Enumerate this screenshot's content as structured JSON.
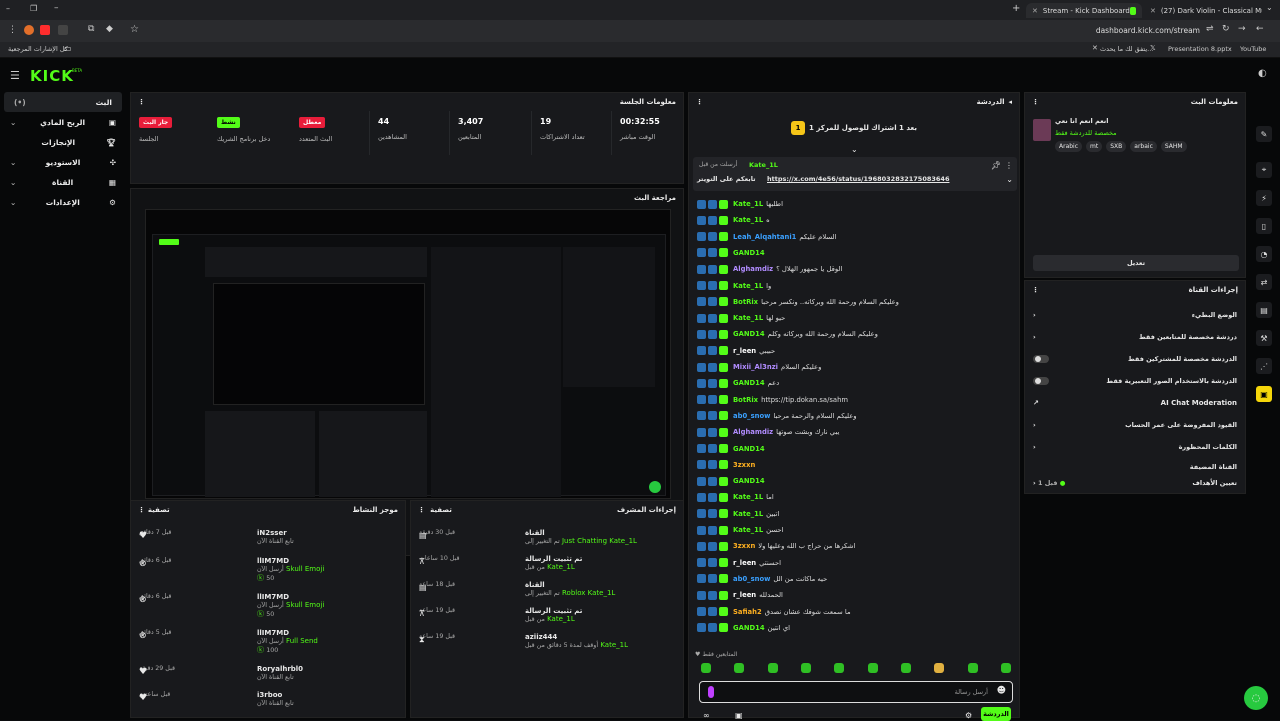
{
  "browser": {
    "tabs": [
      {
        "title": "Stream - Kick Dashboard"
      },
      {
        "title": "(27) Dark Violin - Classical Mu..."
      }
    ],
    "url": "dashboard.kick.com/stream",
    "bookmarks": {
      "all": "كل الإشارات المرجعية",
      "b1": "يتفق لك ما يحدث...",
      "b2": "Presentation 8.pptx",
      "b3": "YouTube"
    }
  },
  "nav": {
    "logo": "KICK",
    "items": [
      {
        "label": "البث"
      },
      {
        "label": "الربح المادي"
      },
      {
        "label": "الإنجازات"
      },
      {
        "label": "الاستوديو"
      },
      {
        "label": "القناة"
      },
      {
        "label": "الإعدادات"
      }
    ]
  },
  "session": {
    "title": "معلومات الجلسة",
    "stats": [
      {
        "value": "جار البث",
        "label": "الجلسة"
      },
      {
        "value": "نشط",
        "label": "دخل برنامج الشريك"
      },
      {
        "value": "معطل",
        "label": "البث المتعدد"
      },
      {
        "value": "44",
        "label": "المشاهدين"
      },
      {
        "value": "3,407",
        "label": "المتابعين"
      },
      {
        "value": "19",
        "label": "تعداد الاشتراكات"
      },
      {
        "value": "00:32:55",
        "label": "الوقت مباشر"
      }
    ]
  },
  "preview": {
    "title": "مراجعة البث"
  },
  "activity": {
    "title": "موجز النشاط",
    "filter": "تصفية",
    "items": [
      {
        "user": "iN2sser",
        "desc": "تابع القناة الآن",
        "time": "قبل 7 دقائق",
        "extra": ""
      },
      {
        "user": "llIM7MD",
        "desc": "أرسل الآن",
        "gift": "Skull Emoji",
        "amount": "50",
        "time": "قبل 6 دقائق"
      },
      {
        "user": "llIM7MD",
        "desc": "أرسل الآن",
        "gift": "Skull Emoji",
        "amount": "50",
        "time": "قبل 6 دقائق"
      },
      {
        "user": "llIM7MD",
        "desc": "أرسل الآن",
        "gift": "Full Send",
        "amount": "100",
        "time": "قبل 5 دقائق"
      },
      {
        "user": "Roryalhrbl0",
        "desc": "تابع القناة الآن",
        "time": "قبل 29 دقيقة",
        "extra": ""
      },
      {
        "user": "i3rboo",
        "desc": "تابع القناة الآن",
        "time": "قبل ساعتين",
        "extra": ""
      }
    ]
  },
  "modactions": {
    "title": "إجراءات المشرف",
    "filter": "تصفية",
    "items": [
      {
        "action": "القناة",
        "detail": "تم التغيير إلى",
        "target": "Just Chatting",
        "by": "Kate_1L",
        "time": "قبل 30 دقيقة"
      },
      {
        "action": "تم تثبيت الرسالة",
        "detail": "من قبل",
        "target": "",
        "by": "Kate_1L",
        "time": "قبل 10 ساعات"
      },
      {
        "action": "القناة",
        "detail": "تم التغيير إلى",
        "target": "Roblox",
        "by": "Kate_1L",
        "time": "قبل 18 ساعة"
      },
      {
        "action": "تم تثبيت الرسالة",
        "detail": "من قبل",
        "target": "",
        "by": "Kate_1L",
        "time": "قبل 19 ساعة"
      },
      {
        "action": "aziiz444",
        "detail": "أوقف لمدة 5 دقائق من قبل",
        "target": "",
        "by": "Kate_1L",
        "time": "قبل 19 ساعة"
      }
    ]
  },
  "chat": {
    "title": "الدردشة",
    "goal": "بعد 1 اشتراك للوصول للمركز 1",
    "goal_num": "1",
    "pinned_user": "Kate_1L",
    "pinned_time": "أرسلت من قبل",
    "pinned_text": "تابعكم على التويتر",
    "pinned_link": "https://x.com/4e56/status/1968032832175083646",
    "lines": [
      {
        "user": "Kate_1L",
        "text": "اطلبها",
        "color": "#53fc18"
      },
      {
        "user": "Kate_1L",
        "text": "ه",
        "color": "#53fc18"
      },
      {
        "user": "Leah_Alqahtani1",
        "text": "السلام عليكم",
        "color": "#3aa0ff"
      },
      {
        "user": "GAND14",
        "text": "",
        "color": "#53fc18"
      },
      {
        "user": "Alghamdiz",
        "text": "الوقل يا جمهور الهلال ؟",
        "color": "#b18cff"
      },
      {
        "user": "Kate_1L",
        "text": "وا",
        "color": "#53fc18"
      },
      {
        "user": "BotRix",
        "text": "وعليكم السلام ورحمة الله وبركاته.. ونكسر مرحبا",
        "color": "#53fc18"
      },
      {
        "user": "Kate_1L",
        "text": "حيو لها",
        "color": "#53fc18"
      },
      {
        "user": "GAND14",
        "text": "وعليكم السلام ورحمة الله وبركاته وكلم",
        "color": "#53fc18"
      },
      {
        "user": "r_leen",
        "text": "حبيبي",
        "color": "#ffffff"
      },
      {
        "user": "Mixii_Al3nzi",
        "text": "وعليكم السلام",
        "color": "#b18cff"
      },
      {
        "user": "GAND14",
        "text": "دعم",
        "color": "#53fc18"
      },
      {
        "user": "BotRix",
        "text": "https://tip.dokan.sa/sahm",
        "color": "#53fc18"
      },
      {
        "user": "ab0_snow",
        "text": "وعليكم السلام والرحمة مرحبا",
        "color": "#3aa0ff"
      },
      {
        "user": "Alghamdiz",
        "text": "يبي نارك وبشت صوتها",
        "color": "#b18cff"
      },
      {
        "user": "GAND14",
        "text": "",
        "color": "#53fc18"
      },
      {
        "user": "3zxxn",
        "text": "",
        "color": "#ffb020"
      },
      {
        "user": "GAND14",
        "text": "",
        "color": "#53fc18"
      },
      {
        "user": "Kate_1L",
        "text": "اما",
        "color": "#53fc18"
      },
      {
        "user": "Kate_1L",
        "text": "اتبين",
        "color": "#53fc18"
      },
      {
        "user": "Kate_1L",
        "text": "احسن",
        "color": "#53fc18"
      },
      {
        "user": "3zxxn",
        "text": "اشكرها من حراج ب الله وعليها ولا",
        "color": "#ffb020"
      },
      {
        "user": "r_leen",
        "text": "احسنتي",
        "color": "#ffffff"
      },
      {
        "user": "ab0_snow",
        "text": "حيه ماكانت من الل",
        "color": "#3aa0ff"
      },
      {
        "user": "r_leen",
        "text": "الحمدلله",
        "color": "#ffffff"
      },
      {
        "user": "Safiah2",
        "text": "ما سمعت شوفك عشان نصدق",
        "color": "#ffb020"
      },
      {
        "user": "GAND14",
        "text": "اي انتين",
        "color": "#53fc18"
      }
    ],
    "input_placeholder": "أرسل رسالة",
    "send_label": "الدردشة",
    "viewers_label": "المتابعين فقط"
  },
  "streaminfo": {
    "title": "معلومات البث",
    "stream_title": "انعم انعم انا نعي",
    "category": "مخصصة للدردشة فقط",
    "tags": [
      "Arabic",
      "mt",
      "SXB",
      "arbaic",
      "SAHM"
    ],
    "edit_label": "تعديل"
  },
  "channelactions": {
    "title": "إجراءات القناة",
    "items": [
      {
        "label": "الوضع البطيء"
      },
      {
        "label": "دردشة مخصصة للمتابعين فقط"
      },
      {
        "label": "الدردشة مخصصة للمشتركين فقط"
      },
      {
        "label": "الدردشة بالاستخدام الصور التعبيرية فقط"
      },
      {
        "label": "AI Chat Moderation"
      },
      {
        "label": "القيود المفروضة على عمر الحساب"
      },
      {
        "label": "الكلمات المحظورة"
      }
    ],
    "extra_title": "القناة المضيفة",
    "extra_label": "تعيين الأهداف",
    "extra_value": "قبل 1"
  }
}
